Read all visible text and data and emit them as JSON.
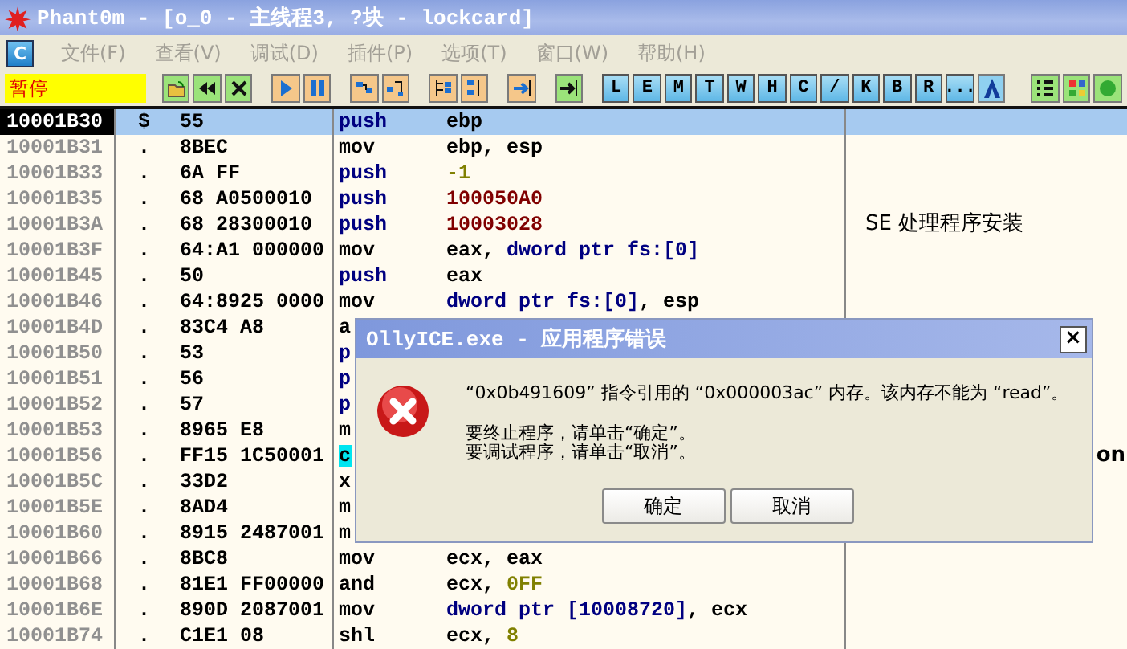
{
  "window": {
    "title": "Phant0m - [o_0 -  主线程3, ?块 - lockcard]"
  },
  "menu": [
    {
      "label": "文件(F)",
      "disabled": true
    },
    {
      "label": "查看(V)",
      "disabled": true
    },
    {
      "label": "调试(D)",
      "disabled": true
    },
    {
      "label": "插件(P)",
      "disabled": true
    },
    {
      "label": "选项(T)",
      "disabled": true
    },
    {
      "label": "窗口(W)",
      "disabled": true
    },
    {
      "label": "帮助(H)",
      "disabled": true
    }
  ],
  "menu_logo": "C",
  "toolbar": {
    "status": "暂停",
    "letter_buttons": [
      "L",
      "E",
      "M",
      "T",
      "W",
      "H",
      "C",
      "/",
      "K",
      "B",
      "R",
      "..."
    ]
  },
  "rows": [
    {
      "address": "10001B30",
      "mark": "$",
      "hex": "55",
      "mnemonic": {
        "text": "push",
        "kind": "stack",
        "highlighted": false
      },
      "selected": true,
      "operands": [
        {
          "text": "ebp",
          "kind": "plain"
        }
      ]
    },
    {
      "address": "10001B31",
      "mark": ".",
      "hex": "8BEC",
      "mnemonic": {
        "text": "mov",
        "kind": "normal",
        "highlighted": false
      },
      "selected": false,
      "operands": [
        {
          "text": "ebp, esp",
          "kind": "plain"
        }
      ]
    },
    {
      "address": "10001B33",
      "mark": ".",
      "hex": "6A FF",
      "mnemonic": {
        "text": "push",
        "kind": "stack",
        "highlighted": false
      },
      "selected": false,
      "operands": [
        {
          "text": "-1",
          "kind": "imm"
        }
      ]
    },
    {
      "address": "10001B35",
      "mark": ".",
      "hex": "68 A0500010",
      "mnemonic": {
        "text": "push",
        "kind": "stack",
        "highlighted": false
      },
      "selected": false,
      "operands": [
        {
          "text": "100050A0",
          "kind": "addr"
        }
      ]
    },
    {
      "address": "10001B3A",
      "mark": ".",
      "hex": "68 28300010",
      "mnemonic": {
        "text": "push",
        "kind": "stack",
        "highlighted": false
      },
      "selected": false,
      "operands": [
        {
          "text": "10003028",
          "kind": "addr"
        }
      ],
      "comment": {
        "text": "SE 处理程序安装",
        "kind": "note"
      }
    },
    {
      "address": "10001B3F",
      "mark": ".",
      "hex": "64:A1 000000",
      "mnemonic": {
        "text": "mov",
        "kind": "normal",
        "highlighted": false
      },
      "selected": false,
      "operands": [
        {
          "text": "eax, ",
          "kind": "plain"
        },
        {
          "text": "dword ptr fs:[0]",
          "kind": "mem"
        }
      ]
    },
    {
      "address": "10001B45",
      "mark": ".",
      "hex": "50",
      "mnemonic": {
        "text": "push",
        "kind": "stack",
        "highlighted": false
      },
      "selected": false,
      "operands": [
        {
          "text": "eax",
          "kind": "plain"
        }
      ]
    },
    {
      "address": "10001B46",
      "mark": ".",
      "hex": "64:8925 0000",
      "mnemonic": {
        "text": "mov",
        "kind": "normal",
        "highlighted": false
      },
      "selected": false,
      "operands": [
        {
          "text": "dword ptr fs:[0]",
          "kind": "mem"
        },
        {
          "text": ", esp",
          "kind": "plain"
        }
      ]
    },
    {
      "address": "10001B4D",
      "mark": ".",
      "hex": "83C4 A8",
      "mnemonic": {
        "text": "a",
        "kind": "normal",
        "highlighted": false
      },
      "selected": false,
      "operands": []
    },
    {
      "address": "10001B50",
      "mark": ".",
      "hex": "53",
      "mnemonic": {
        "text": "p",
        "kind": "stack",
        "highlighted": false
      },
      "selected": false,
      "operands": []
    },
    {
      "address": "10001B51",
      "mark": ".",
      "hex": "56",
      "mnemonic": {
        "text": "p",
        "kind": "stack",
        "highlighted": false
      },
      "selected": false,
      "operands": []
    },
    {
      "address": "10001B52",
      "mark": ".",
      "hex": "57",
      "mnemonic": {
        "text": "p",
        "kind": "stack",
        "highlighted": false
      },
      "selected": false,
      "operands": []
    },
    {
      "address": "10001B53",
      "mark": ".",
      "hex": "8965 E8",
      "mnemonic": {
        "text": "m",
        "kind": "normal",
        "highlighted": false
      },
      "selected": false,
      "operands": []
    },
    {
      "address": "10001B56",
      "mark": ".",
      "hex": "FF15 1C50001",
      "mnemonic": {
        "text": "c",
        "kind": "normal",
        "highlighted": true
      },
      "selected": false,
      "operands": [],
      "comment": {
        "text": "on",
        "kind": "clipped"
      }
    },
    {
      "address": "10001B5C",
      "mark": ".",
      "hex": "33D2",
      "mnemonic": {
        "text": "x",
        "kind": "normal",
        "highlighted": false
      },
      "selected": false,
      "operands": []
    },
    {
      "address": "10001B5E",
      "mark": ".",
      "hex": "8AD4",
      "mnemonic": {
        "text": "m",
        "kind": "normal",
        "highlighted": false
      },
      "selected": false,
      "operands": []
    },
    {
      "address": "10001B60",
      "mark": ".",
      "hex": "8915 2487001",
      "mnemonic": {
        "text": "m",
        "kind": "normal",
        "highlighted": false
      },
      "selected": false,
      "operands": []
    },
    {
      "address": "10001B66",
      "mark": ".",
      "hex": "8BC8",
      "mnemonic": {
        "text": "mov",
        "kind": "normal",
        "highlighted": false
      },
      "selected": false,
      "operands": [
        {
          "text": "ecx, eax",
          "kind": "plain"
        }
      ]
    },
    {
      "address": "10001B68",
      "mark": ".",
      "hex": "81E1 FF00000",
      "mnemonic": {
        "text": "and",
        "kind": "normal",
        "highlighted": false
      },
      "selected": false,
      "operands": [
        {
          "text": "ecx, ",
          "kind": "plain"
        },
        {
          "text": "0FF",
          "kind": "imm"
        }
      ]
    },
    {
      "address": "10001B6E",
      "mark": ".",
      "hex": "890D 2087001",
      "mnemonic": {
        "text": "mov",
        "kind": "normal",
        "highlighted": false
      },
      "selected": false,
      "operands": [
        {
          "text": "dword ptr [10008720]",
          "kind": "mem"
        },
        {
          "text": ", ecx",
          "kind": "plain"
        }
      ]
    },
    {
      "address": "10001B74",
      "mark": ".",
      "hex": "C1E1 08",
      "mnemonic": {
        "text": "shl",
        "kind": "normal",
        "highlighted": false
      },
      "selected": false,
      "operands": [
        {
          "text": "ecx, ",
          "kind": "plain"
        },
        {
          "text": "8",
          "kind": "imm"
        }
      ]
    }
  ],
  "dialog": {
    "title": "OllyICE.exe - 应用程序错误",
    "message": "“0x0b491609” 指令引用的 “0x000003ac” 内存。该内存不能为 “read”。",
    "instructions": [
      "要终止程序，请单击“确定”。",
      "要调试程序，请单击“取消”。"
    ],
    "close": "×",
    "buttons": [
      "确定",
      "取消"
    ]
  }
}
